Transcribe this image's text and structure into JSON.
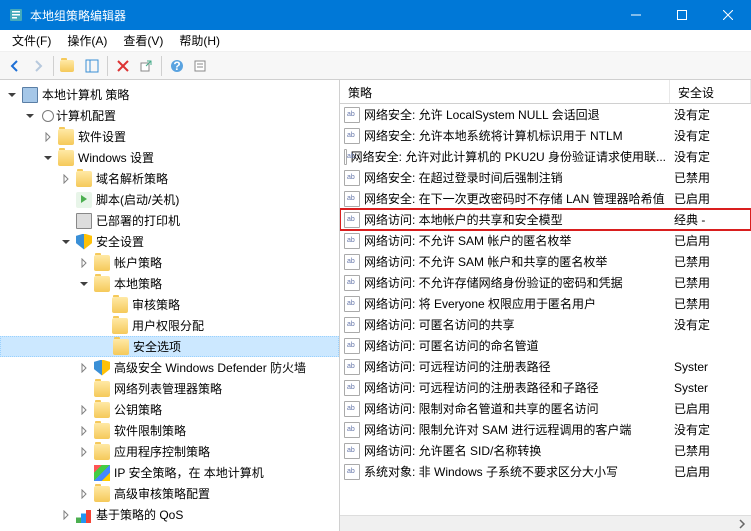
{
  "window": {
    "title": "本地组策略编辑器"
  },
  "menu": {
    "file": "文件(F)",
    "action": "操作(A)",
    "view": "查看(V)",
    "help": "帮助(H)"
  },
  "tree": {
    "root": "本地计算机 策略",
    "computerConfig": "计算机配置",
    "softwareSettings": "软件设置",
    "windowsSettings": "Windows 设置",
    "nameResolution": "域名解析策略",
    "scripts": "脚本(启动/关机)",
    "printers": "已部署的打印机",
    "securitySettings": "安全设置",
    "accountPolicies": "帐户策略",
    "localPolicies": "本地策略",
    "auditPolicy": "审核策略",
    "userRights": "用户权限分配",
    "securityOptions": "安全选项",
    "defender": "高级安全 Windows Defender 防火墙",
    "networkList": "网络列表管理器策略",
    "publicKey": "公钥策略",
    "softwareRestriction": "软件限制策略",
    "appControl": "应用程序控制策略",
    "ipsec": "IP 安全策略，在 本地计算机",
    "advancedAudit": "高级审核策略配置",
    "qos": "基于策略的 QoS"
  },
  "columns": {
    "policy": "策略",
    "setting": "安全设"
  },
  "rows": [
    {
      "policy": "网络安全: 允许 LocalSystem NULL 会话回退",
      "setting": "没有定"
    },
    {
      "policy": "网络安全: 允许本地系统将计算机标识用于 NTLM",
      "setting": "没有定"
    },
    {
      "policy": "网络安全: 允许对此计算机的 PKU2U 身份验证请求使用联...",
      "setting": "没有定"
    },
    {
      "policy": "网络安全: 在超过登录时间后强制注销",
      "setting": "已禁用"
    },
    {
      "policy": "网络安全: 在下一次更改密码时不存储 LAN 管理器哈希值",
      "setting": "已启用"
    },
    {
      "policy": "网络访问: 本地帐户的共享和安全模型",
      "setting": "经典 - ",
      "hl": true
    },
    {
      "policy": "网络访问: 不允许 SAM 帐户的匿名枚举",
      "setting": "已启用"
    },
    {
      "policy": "网络访问: 不允许 SAM 帐户和共享的匿名枚举",
      "setting": "已禁用"
    },
    {
      "policy": "网络访问: 不允许存储网络身份验证的密码和凭据",
      "setting": "已禁用"
    },
    {
      "policy": "网络访问: 将 Everyone 权限应用于匿名用户",
      "setting": "已禁用"
    },
    {
      "policy": "网络访问: 可匿名访问的共享",
      "setting": "没有定"
    },
    {
      "policy": "网络访问: 可匿名访问的命名管道",
      "setting": ""
    },
    {
      "policy": "网络访问: 可远程访问的注册表路径",
      "setting": "Syster"
    },
    {
      "policy": "网络访问: 可远程访问的注册表路径和子路径",
      "setting": "Syster"
    },
    {
      "policy": "网络访问: 限制对命名管道和共享的匿名访问",
      "setting": "已启用"
    },
    {
      "policy": "网络访问: 限制允许对 SAM 进行远程调用的客户端",
      "setting": "没有定"
    },
    {
      "policy": "网络访问: 允许匿名 SID/名称转换",
      "setting": "已禁用"
    },
    {
      "policy": "系统对象: 非 Windows 子系统不要求区分大小写",
      "setting": "已启用"
    }
  ]
}
